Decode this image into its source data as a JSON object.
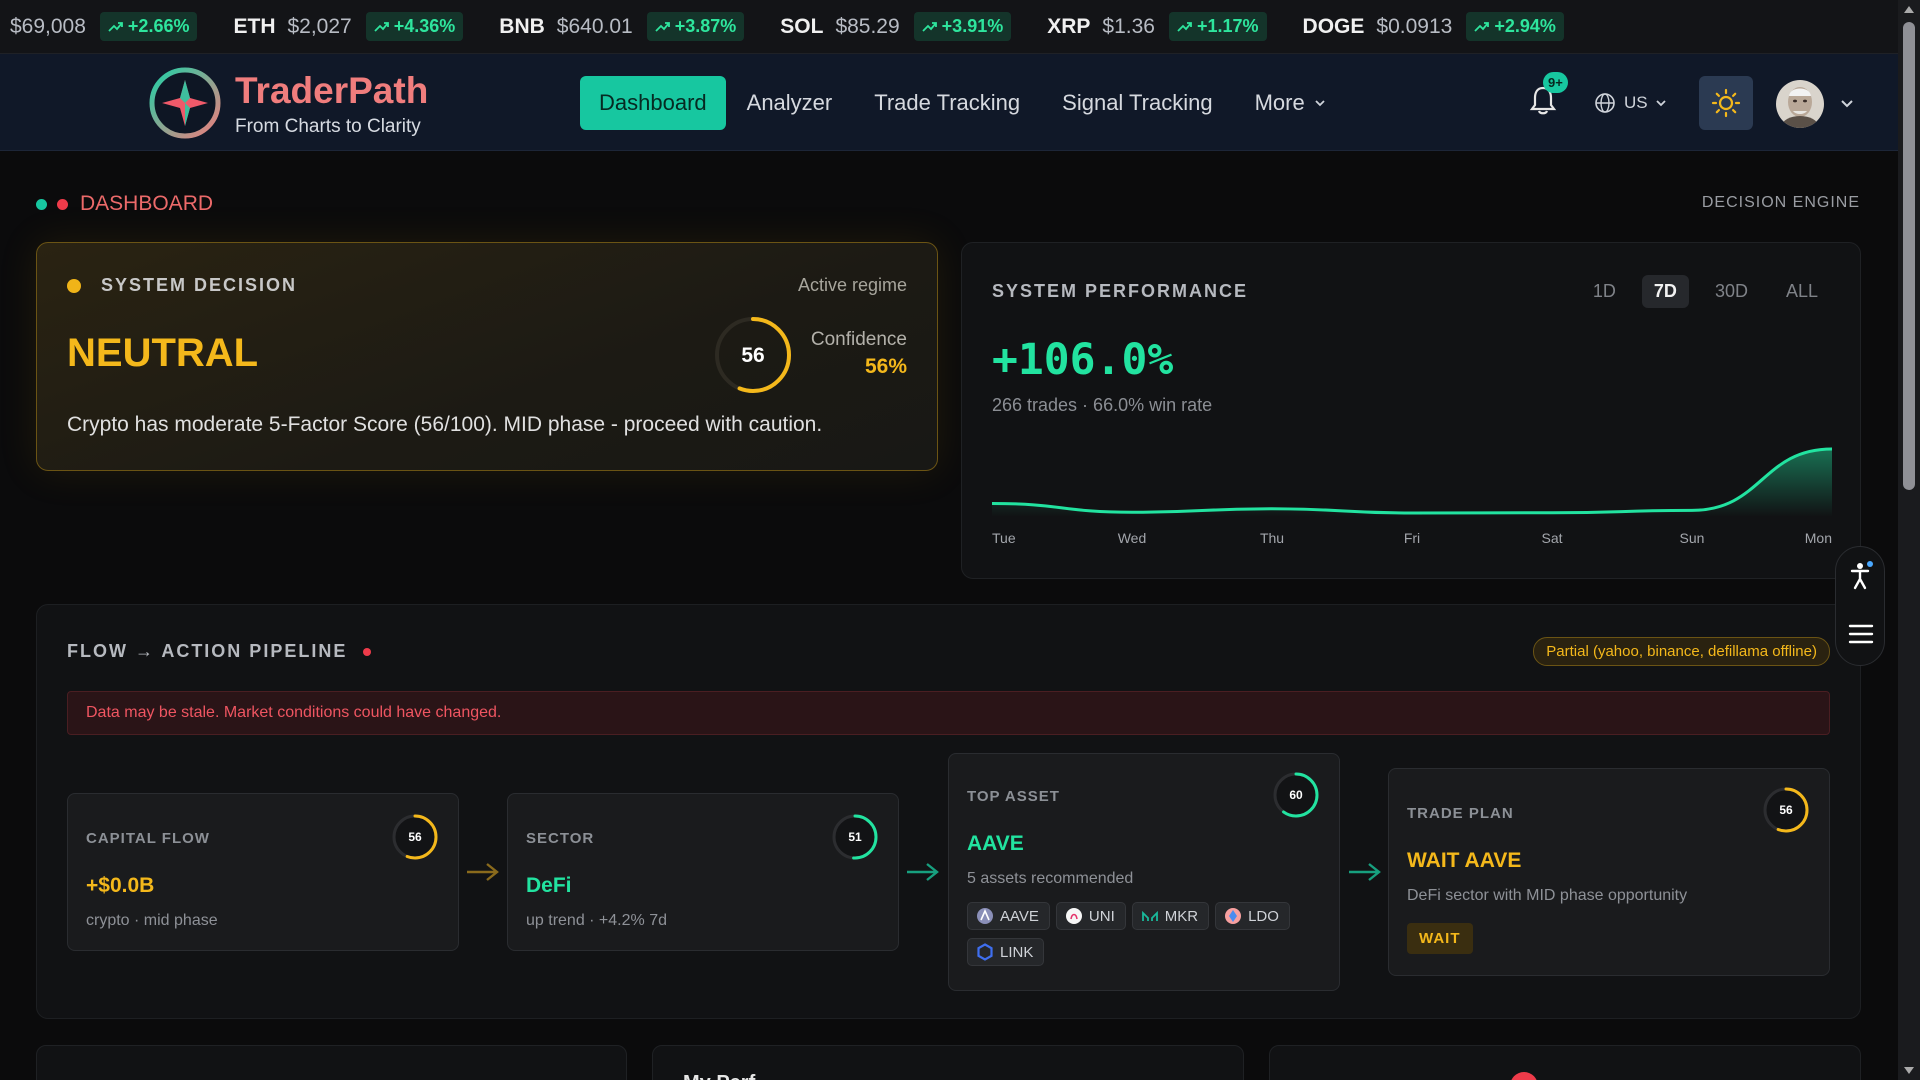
{
  "ticker": [
    {
      "symbol": "",
      "price": "$69,008",
      "change": "+2.66%"
    },
    {
      "symbol": "ETH",
      "price": "$2,027",
      "change": "+4.36%"
    },
    {
      "symbol": "BNB",
      "price": "$640.01",
      "change": "+3.87%"
    },
    {
      "symbol": "SOL",
      "price": "$85.29",
      "change": "+3.91%"
    },
    {
      "symbol": "XRP",
      "price": "$1.36",
      "change": "+1.17%"
    },
    {
      "symbol": "DOGE",
      "price": "$0.0913",
      "change": "+2.94%"
    }
  ],
  "brand": {
    "name": "TraderPath",
    "tagline": "From Charts to Clarity"
  },
  "nav": {
    "items": [
      {
        "label": "Dashboard",
        "active": true
      },
      {
        "label": "Analyzer"
      },
      {
        "label": "Trade Tracking"
      },
      {
        "label": "Signal Tracking"
      },
      {
        "label": "More"
      }
    ],
    "notif_badge": "9+",
    "lang": "US"
  },
  "page": {
    "breadcrumb": "DASHBOARD",
    "engine_label": "DECISION ENGINE"
  },
  "decision": {
    "header": "SYSTEM DECISION",
    "regime": "Active regime",
    "verdict": "NEUTRAL",
    "score": "56",
    "score_value": 56,
    "confidence_label": "Confidence",
    "confidence": "56%",
    "description": "Crypto has moderate 5-Factor Score (56/100). MID phase - proceed with caution."
  },
  "performance": {
    "header": "SYSTEM PERFORMANCE",
    "ranges": [
      "1D",
      "7D",
      "30D",
      "ALL"
    ],
    "active_range": "7D",
    "return": "+106.0%",
    "summary": "266 trades · 66.0% win rate"
  },
  "chart_data": {
    "type": "line",
    "x": [
      "Tue",
      "Wed",
      "Thu",
      "Fri",
      "Sat",
      "Sun",
      "Mon"
    ],
    "series": [
      {
        "values": [
          0.84,
          0.1,
          0.4,
          0.04,
          0.06,
          0.26,
          5.4
        ]
      }
    ]
  },
  "pipeline": {
    "header": "FLOW → ACTION PIPELINE",
    "status": "Partial (yahoo, binance, defillama offline)",
    "warning": "Data may be stale. Market conditions could have changed.",
    "steps": [
      {
        "label": "CAPITAL FLOW",
        "value": "+$0.0B",
        "note": "crypto · mid phase",
        "score": "56",
        "score_value": 56
      },
      {
        "label": "SECTOR",
        "value": "DeFi",
        "note": "up trend · +4.2% 7d",
        "score": "51",
        "score_value": 51
      },
      {
        "label": "TOP ASSET",
        "value": "AAVE",
        "note": "5 assets recommended",
        "score": "60",
        "score_value": 60,
        "assets": [
          "AAVE",
          "UNI",
          "MKR",
          "LDO",
          "LINK"
        ]
      },
      {
        "label": "TRADE PLAN",
        "value": "WAIT AAVE",
        "note": "DeFi sector with MID phase opportunity",
        "score": "56",
        "score_value": 56,
        "action": "WAIT"
      }
    ]
  },
  "bottom_title": "My Perf",
  "colors": {
    "accent": "#17c7a0",
    "gold": "#f4b81b",
    "green": "#22e3a0",
    "red": "#ee3b4a"
  }
}
